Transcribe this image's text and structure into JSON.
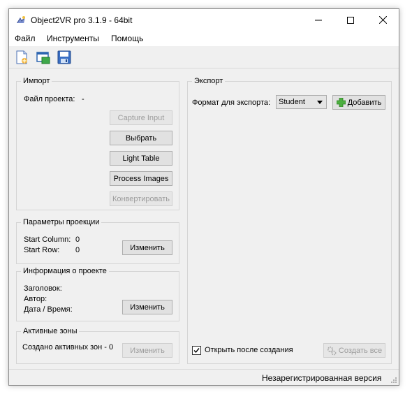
{
  "window": {
    "title": "Object2VR pro 3.1.9 - 64bit"
  },
  "menu": {
    "file": "Файл",
    "tools": "Инструменты",
    "help": "Помощь"
  },
  "toolbar": {
    "icons": [
      "new-project-icon",
      "open-project-icon",
      "save-project-icon"
    ]
  },
  "import": {
    "title": "Импорт",
    "project_file_label": "Файл проекта:",
    "project_file_value": "-",
    "capture_input": "Capture Input",
    "choose": "Выбрать",
    "light_table": "Light Table",
    "process_images": "Process Images",
    "convert": "Конвертировать"
  },
  "projection": {
    "title": "Параметры проекции",
    "start_column_label": "Start Column:",
    "start_column_value": "0",
    "start_row_label": "Start Row:",
    "start_row_value": "0",
    "change": "Изменить"
  },
  "project_info": {
    "title": "Информация о проекте",
    "heading_label": "Заголовок:",
    "author_label": "Автор:",
    "datetime_label": "Дата / Время:",
    "change": "Изменить"
  },
  "hotspots": {
    "title": "Активные зоны",
    "created_text": "Создано активных зон - 0",
    "change": "Изменить"
  },
  "export": {
    "title": "Экспорт",
    "format_label": "Формат для экспорта:",
    "format_value": "Student",
    "add": "Добавить",
    "open_after_label": "Открыть после создания",
    "open_after_checked": true,
    "create_all": "Создать все"
  },
  "status": {
    "text": "Незарегистрированная версия"
  }
}
